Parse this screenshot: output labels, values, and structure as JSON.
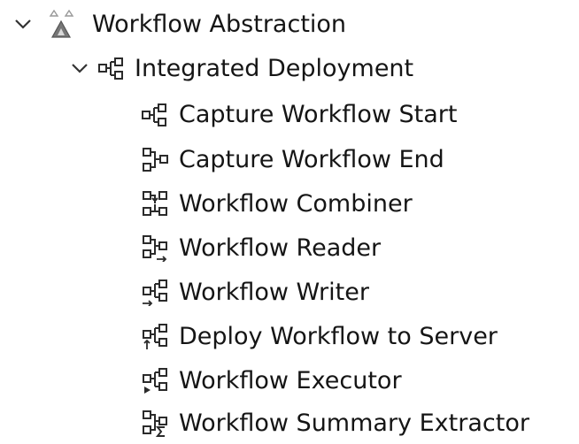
{
  "tree": {
    "root": {
      "label": "Workflow Abstraction",
      "icon": "workflow-abstraction-icon",
      "expanded": true
    },
    "group": {
      "label": "Integrated Deployment",
      "icon": "integrated-deployment-icon",
      "expanded": true
    },
    "items": [
      {
        "label": "Capture Workflow Start",
        "icon": "capture-workflow-start-icon"
      },
      {
        "label": "Capture Workflow End",
        "icon": "capture-workflow-end-icon"
      },
      {
        "label": "Workflow Combiner",
        "icon": "workflow-combiner-icon"
      },
      {
        "label": "Workflow Reader",
        "icon": "workflow-reader-icon"
      },
      {
        "label": "Workflow Writer",
        "icon": "workflow-writer-icon"
      },
      {
        "label": "Deploy Workflow to Server",
        "icon": "deploy-workflow-to-server-icon"
      },
      {
        "label": "Workflow Executor",
        "icon": "workflow-executor-icon"
      },
      {
        "label": "Workflow Summary Extractor",
        "icon": "workflow-summary-extractor-icon"
      }
    ]
  },
  "colors": {
    "background": "#ffffff",
    "text": "#151515",
    "icon": "#2b2b2b",
    "abstraction_triangle": "#8a8a8a"
  }
}
